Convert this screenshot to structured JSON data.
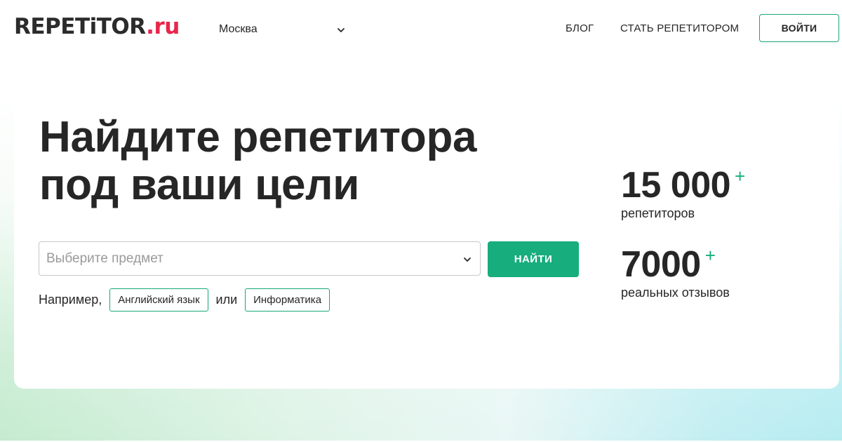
{
  "header": {
    "logo_main": "REPETiTOR",
    "logo_suffix": ".ru",
    "city": "Москва",
    "nav_blog": "БЛОГ",
    "nav_become_tutor": "СТАТЬ РЕПЕТИТОРОМ",
    "login": "ВОЙТИ"
  },
  "hero": {
    "title_line1": "Найдите репетитора",
    "title_line2": "под ваши цели",
    "search_placeholder": "Выберите предмет",
    "search_button": "НАЙТИ",
    "example_prefix": "Например,",
    "example_1": "Английский язык",
    "example_or": "или",
    "example_2": "Информатика"
  },
  "stats": [
    {
      "value": "15 000",
      "plus": "+",
      "label": "репетиторов"
    },
    {
      "value": "7000",
      "plus": "+",
      "label": "реальных отзывов"
    }
  ],
  "colors": {
    "brand_red": "#e8254b",
    "accent_green": "#17ad7c",
    "text": "#262626"
  }
}
